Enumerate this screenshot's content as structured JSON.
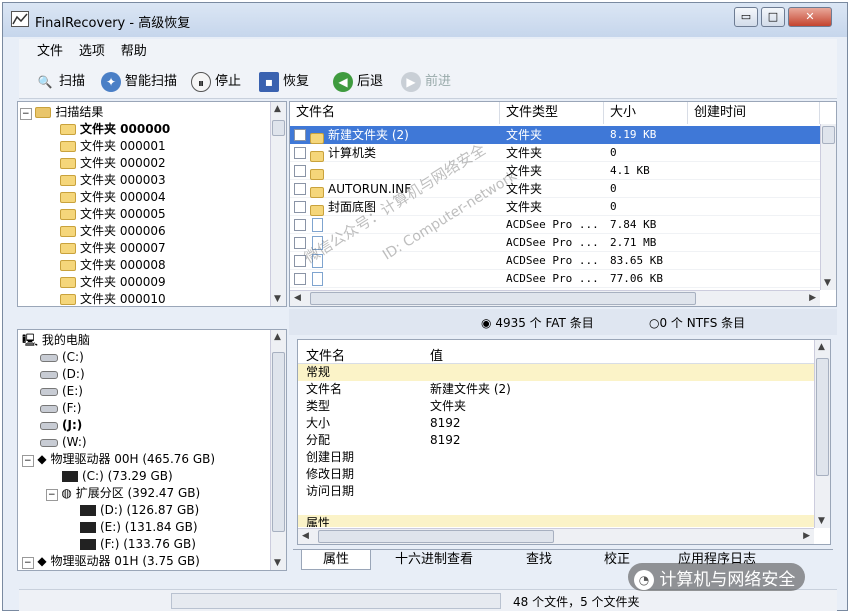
{
  "window": {
    "title": "FinalRecovery - 高级恢复",
    "controls": [
      "▭",
      "□",
      "✕"
    ]
  },
  "menu": [
    "文件",
    "选项",
    "帮助"
  ],
  "toolbar": {
    "scan": "扫描",
    "smart_scan": "智能扫描",
    "stop": "停止",
    "restore": "恢复",
    "back": "后退",
    "forward": "前进"
  },
  "scan_tree": {
    "root": "扫描结果",
    "items": [
      "文件夹 000000",
      "文件夹 000001",
      "文件夹 000002",
      "文件夹 000003",
      "文件夹 000004",
      "文件夹 000005",
      "文件夹 000006",
      "文件夹 000007",
      "文件夹 000008",
      "文件夹 000009",
      "文件夹 000010"
    ]
  },
  "file_list": {
    "columns": [
      "文件名",
      "文件类型",
      "大小",
      "创建时间"
    ],
    "rows": [
      {
        "name": "新建文件夹 (2)",
        "type": "文件夹",
        "size": "8.19 KB",
        "kind": "folder",
        "selected": true
      },
      {
        "name": "计算机类",
        "type": "文件夹",
        "size": "0",
        "kind": "folder"
      },
      {
        "name": "",
        "type": "文件夹",
        "size": "4.1 KB",
        "kind": "folder"
      },
      {
        "name": "AUTORUN.INF",
        "type": "文件夹",
        "size": "0",
        "kind": "folder"
      },
      {
        "name": "封面底图",
        "type": "文件夹",
        "size": "0",
        "kind": "folder"
      },
      {
        "name": "",
        "type": "ACDSee Pro ...",
        "size": "7.84 KB",
        "kind": "file"
      },
      {
        "name": "",
        "type": "ACDSee Pro ...",
        "size": "2.71 MB",
        "kind": "file"
      },
      {
        "name": "",
        "type": "ACDSee Pro ...",
        "size": "83.65 KB",
        "kind": "file"
      },
      {
        "name": "",
        "type": "ACDSee Pro ...",
        "size": "77.06 KB",
        "kind": "file"
      }
    ]
  },
  "fs_options": {
    "fat": "4935 个 FAT 条目",
    "ntfs": "0 个 NTFS 条目"
  },
  "computer_tree": {
    "root": "我的电脑",
    "drives": [
      "(C:)",
      "(D:)",
      "(E:)",
      "(F:)",
      "(J:)",
      "(W:)"
    ],
    "disk0": "物理驱动器 00H (465.76 GB)",
    "disk0_c": "(C:)    (73.29 GB)",
    "ext": "扩展分区 (392.47 GB)",
    "ext_parts": [
      "(D:)    (126.87 GB)",
      "(E:)    (131.84 GB)",
      "(F:)    (133.76 GB)"
    ],
    "disk1": "物理驱动器 01H (3.75 GB)"
  },
  "properties": {
    "columns": [
      "文件名",
      "值"
    ],
    "group1": "常规",
    "rows": [
      {
        "k": "文件名",
        "v": "新建文件夹 (2)"
      },
      {
        "k": "类型",
        "v": "文件夹"
      },
      {
        "k": "大小",
        "v": "8192"
      },
      {
        "k": "分配",
        "v": "8192"
      },
      {
        "k": "创建日期",
        "v": ""
      },
      {
        "k": "修改日期",
        "v": ""
      },
      {
        "k": "访问日期",
        "v": ""
      }
    ],
    "group2": "属性"
  },
  "tabs": [
    "属性",
    "十六进制查看",
    "查找",
    "校正",
    "应用程序日志"
  ],
  "status": {
    "text": "48 个文件，5 个文件夹"
  },
  "watermark": {
    "text": "计算机与网络安全",
    "diag1": "微信公众号：计算机与网络安全",
    "diag2": "ID: Computer-network"
  }
}
